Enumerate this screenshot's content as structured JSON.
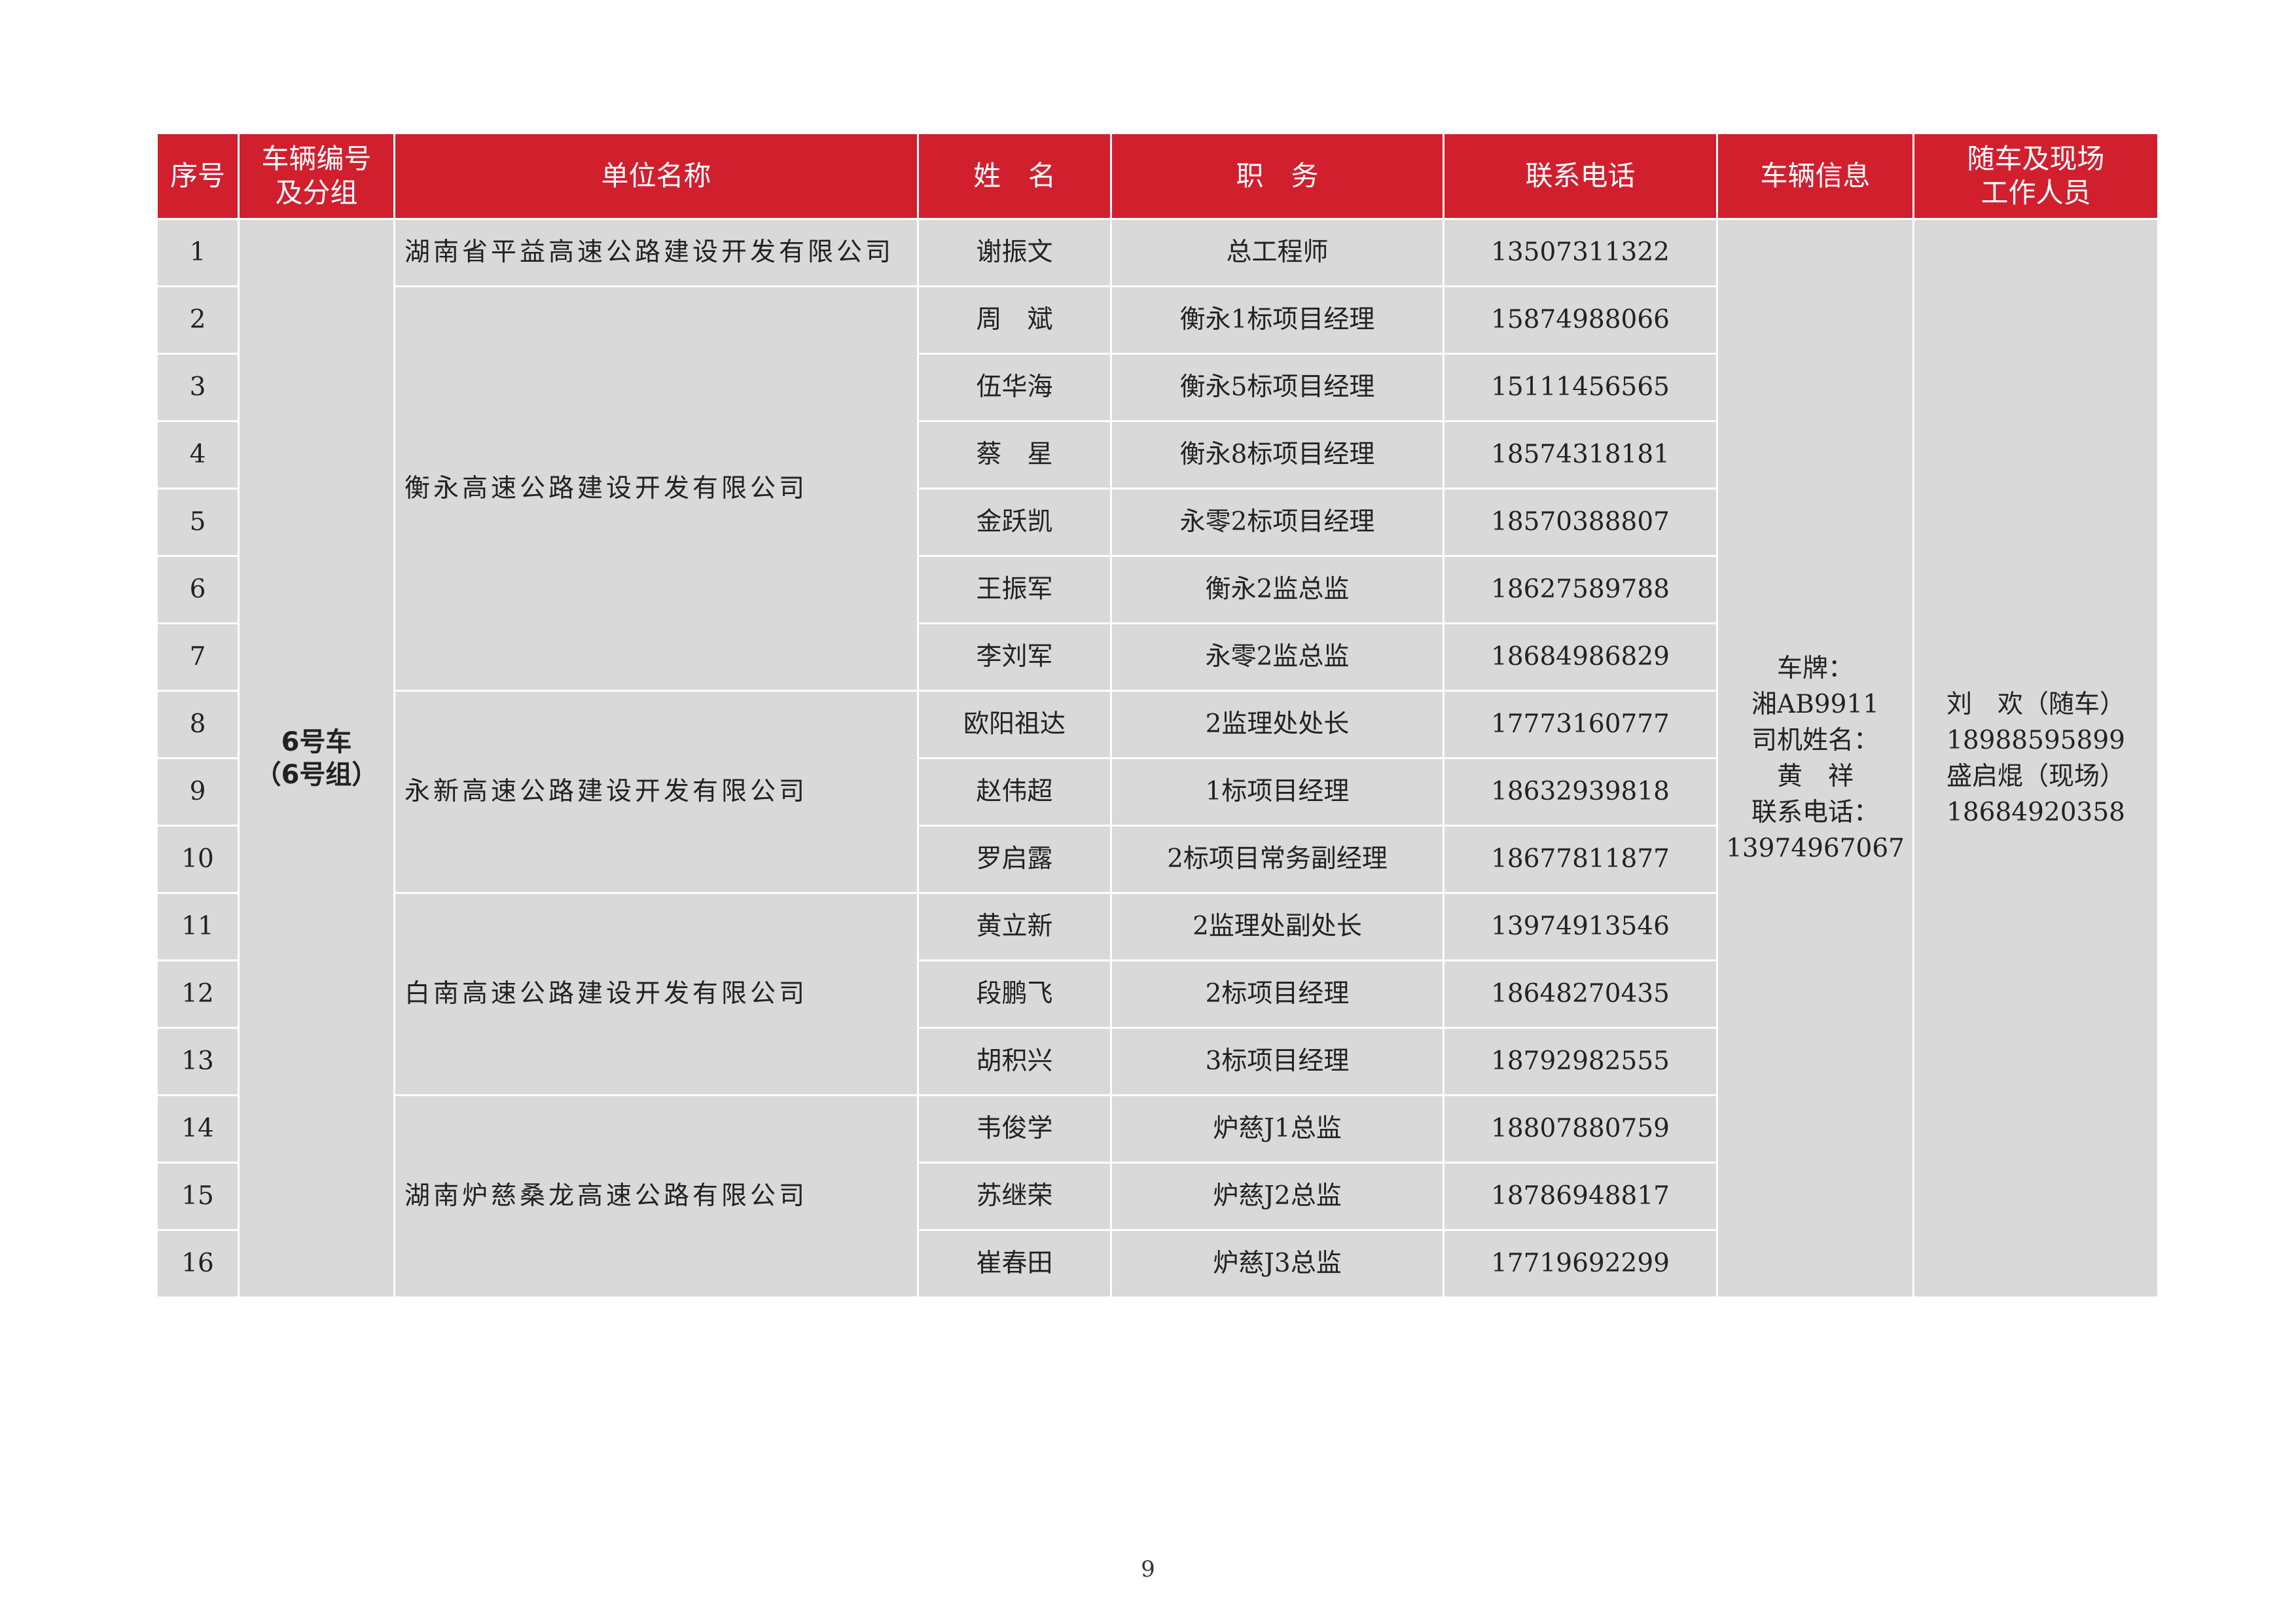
{
  "table": {
    "headers": {
      "seq": "序号",
      "car_line1": "车辆编号",
      "car_line2": "及分组",
      "unit": "单位名称",
      "name": "姓　名",
      "position": "职　务",
      "phone": "联系电话",
      "vehicle_info": "车辆信息",
      "staff_line1": "随车及现场",
      "staff_line2": "工作人员"
    },
    "car_group": {
      "line1": "6号车",
      "line2": "（6号组）"
    },
    "units": [
      "湖南省平益高速公路建设开发有限公司",
      "衡永高速公路建设开发有限公司",
      "永新高速公路建设开发有限公司",
      "白南高速公路建设开发有限公司",
      "湖南炉慈桑龙高速公路有限公司"
    ],
    "rows": [
      {
        "seq": "1",
        "name": "谢振文",
        "position": "总工程师",
        "phone": "13507311322"
      },
      {
        "seq": "2",
        "name": "周　斌",
        "position": "衡永1标项目经理",
        "phone": "15874988066"
      },
      {
        "seq": "3",
        "name": "伍华海",
        "position": "衡永5标项目经理",
        "phone": "15111456565"
      },
      {
        "seq": "4",
        "name": "蔡　星",
        "position": "衡永8标项目经理",
        "phone": "18574318181"
      },
      {
        "seq": "5",
        "name": "金跃凯",
        "position": "永零2标项目经理",
        "phone": "18570388807"
      },
      {
        "seq": "6",
        "name": "王振军",
        "position": "衡永2监总监",
        "phone": "18627589788"
      },
      {
        "seq": "7",
        "name": "李刘军",
        "position": "永零2监总监",
        "phone": "18684986829"
      },
      {
        "seq": "8",
        "name": "欧阳祖达",
        "position": "2监理处处长",
        "phone": "17773160777"
      },
      {
        "seq": "9",
        "name": "赵伟超",
        "position": "1标项目经理",
        "phone": "18632939818"
      },
      {
        "seq": "10",
        "name": "罗启露",
        "position": "2标项目常务副经理",
        "phone": "18677811877"
      },
      {
        "seq": "11",
        "name": "黄立新",
        "position": "2监理处副处长",
        "phone": "13974913546"
      },
      {
        "seq": "12",
        "name": "段鹏飞",
        "position": "2标项目经理",
        "phone": "18648270435"
      },
      {
        "seq": "13",
        "name": "胡积兴",
        "position": "3标项目经理",
        "phone": "18792982555"
      },
      {
        "seq": "14",
        "name": "韦俊学",
        "position": "炉慈J1总监",
        "phone": "18807880759"
      },
      {
        "seq": "15",
        "name": "苏继荣",
        "position": "炉慈J2总监",
        "phone": "18786948817"
      },
      {
        "seq": "16",
        "name": "崔春田",
        "position": "炉慈J3总监",
        "phone": "17719692299"
      }
    ],
    "vehicle_info": [
      "车牌：",
      "湘AB9911",
      "司机姓名：",
      "黄　祥",
      "联系电话：",
      "13974967067"
    ],
    "staff": [
      "刘　欢（随车）",
      "18988595899",
      "盛启焜（现场）",
      "18684920358"
    ]
  },
  "page_number": "9",
  "colors": {
    "header_bg": "#d11f2e",
    "header_text": "#ffffff",
    "cell_bg": "#d9d9d9",
    "border": "#ffffff"
  }
}
